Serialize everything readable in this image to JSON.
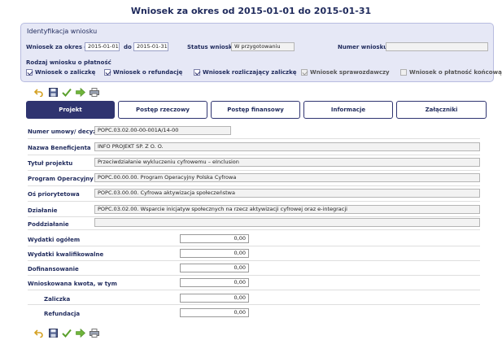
{
  "page": {
    "title": "Wniosek za okres od 2015-01-01 do 2015-01-31"
  },
  "identification": {
    "heading": "Identyfikacja wniosku",
    "period_label": "Wniosek za okres od",
    "period_from": "2015-01-01",
    "period_to_label": "do",
    "period_to": "2015-01-31",
    "status_label": "Status wniosku",
    "status_value": "W przygotowaniu",
    "number_label": "Numer wniosku",
    "number_value": "",
    "kind_label": "Rodzaj wniosku o płatność",
    "kinds": [
      {
        "label": "Wniosek o zaliczkę",
        "checked": true
      },
      {
        "label": "Wniosek o refundację",
        "checked": true
      },
      {
        "label": "Wniosek rozliczający zaliczkę",
        "checked": true
      },
      {
        "label": "Wniosek sprawozdawczy",
        "checked": true
      },
      {
        "label": "Wniosek o płatność końcową",
        "checked": false
      }
    ]
  },
  "toolbar_icons": [
    "undo-icon",
    "save-icon",
    "check-icon",
    "forward-icon",
    "print-icon"
  ],
  "tabs": [
    {
      "label": "Projekt",
      "active": true
    },
    {
      "label": "Postęp rzeczowy",
      "active": false
    },
    {
      "label": "Postęp finansowy",
      "active": false
    },
    {
      "label": "Informacje",
      "active": false
    },
    {
      "label": "Załączniki",
      "active": false
    }
  ],
  "project": {
    "contract_label": "Numer umowy/ decyzji",
    "contract_value": "POPC.03.02.00-00-001A/14-00",
    "beneficiary_label": "Nazwa Beneficjenta",
    "beneficiary_value": "INFO PROJEKT SP. Z O. O.",
    "title_label": "Tytuł projektu",
    "title_value": "Przeciwdziałanie wykluczeniu cyfrowemu – eInclusion",
    "program_label": "Program Operacyjny",
    "program_value": "POPC.00.00.00. Program Operacyjny Polska Cyfrowa",
    "axis_label": "Oś priorytetowa",
    "axis_value": "POPC.03.00.00. Cyfrowa aktywizacja społeczeństwa",
    "measure_label": "Działanie",
    "measure_value": "POPC.03.02.00. Wsparcie inicjatyw społecznych na rzecz aktywizacji cyfrowej oraz e-integracji",
    "submeasure_label": "Poddziałanie",
    "submeasure_value": ""
  },
  "finance": {
    "total_label": "Wydatki ogółem",
    "total_value": "0,00",
    "eligible_label": "Wydatki kwalifikowalne",
    "eligible_value": "0,00",
    "cofinancing_label": "Dofinansowanie",
    "cofinancing_value": "0,00",
    "requested_label": "Wnioskowana kwota, w tym",
    "requested_value": "0,00",
    "advance_label": "Zaliczka",
    "advance_value": "0,00",
    "refund_label": "Refundacja",
    "refund_value": "0,00"
  }
}
